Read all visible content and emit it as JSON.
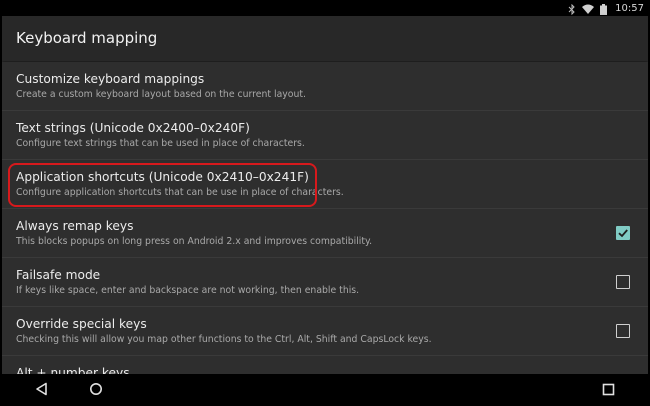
{
  "status_bar": {
    "time": "10:57",
    "icons": [
      "bluetooth-icon",
      "wifi-icon",
      "battery-icon"
    ]
  },
  "app_bar": {
    "title": "Keyboard mapping"
  },
  "settings": [
    {
      "title": "Customize keyboard mappings",
      "summary": "Create a custom keyboard layout based on the current layout."
    },
    {
      "title": "Text strings (Unicode 0x2400–0x240F)",
      "summary": "Configure text strings that can be used in place of characters."
    },
    {
      "title": "Application shortcuts (Unicode 0x2410–0x241F)",
      "summary": "Configure application shortcuts that can be use in place of characters.",
      "highlighted": true
    },
    {
      "title": "Always remap keys",
      "summary": "This blocks popups on long press on Android 2.x and improves compatibility.",
      "checked": true
    },
    {
      "title": "Failsafe mode",
      "summary": "If keys like space, enter and backspace are not working, then enable this.",
      "checked": false
    },
    {
      "title": "Override special keys",
      "summary": "Checking this will allow you map other functions to the Ctrl, Alt, Shift and CapsLock keys.",
      "checked": false
    },
    {
      "title": "Alt + number keys",
      "summary": ""
    }
  ],
  "colors": {
    "checkbox_checked": "#80cbc4",
    "highlight_outline": "#d7191c",
    "background": "#303030"
  },
  "nav_bar": {
    "icons": [
      "back-icon",
      "home-icon",
      "recents-icon"
    ]
  }
}
